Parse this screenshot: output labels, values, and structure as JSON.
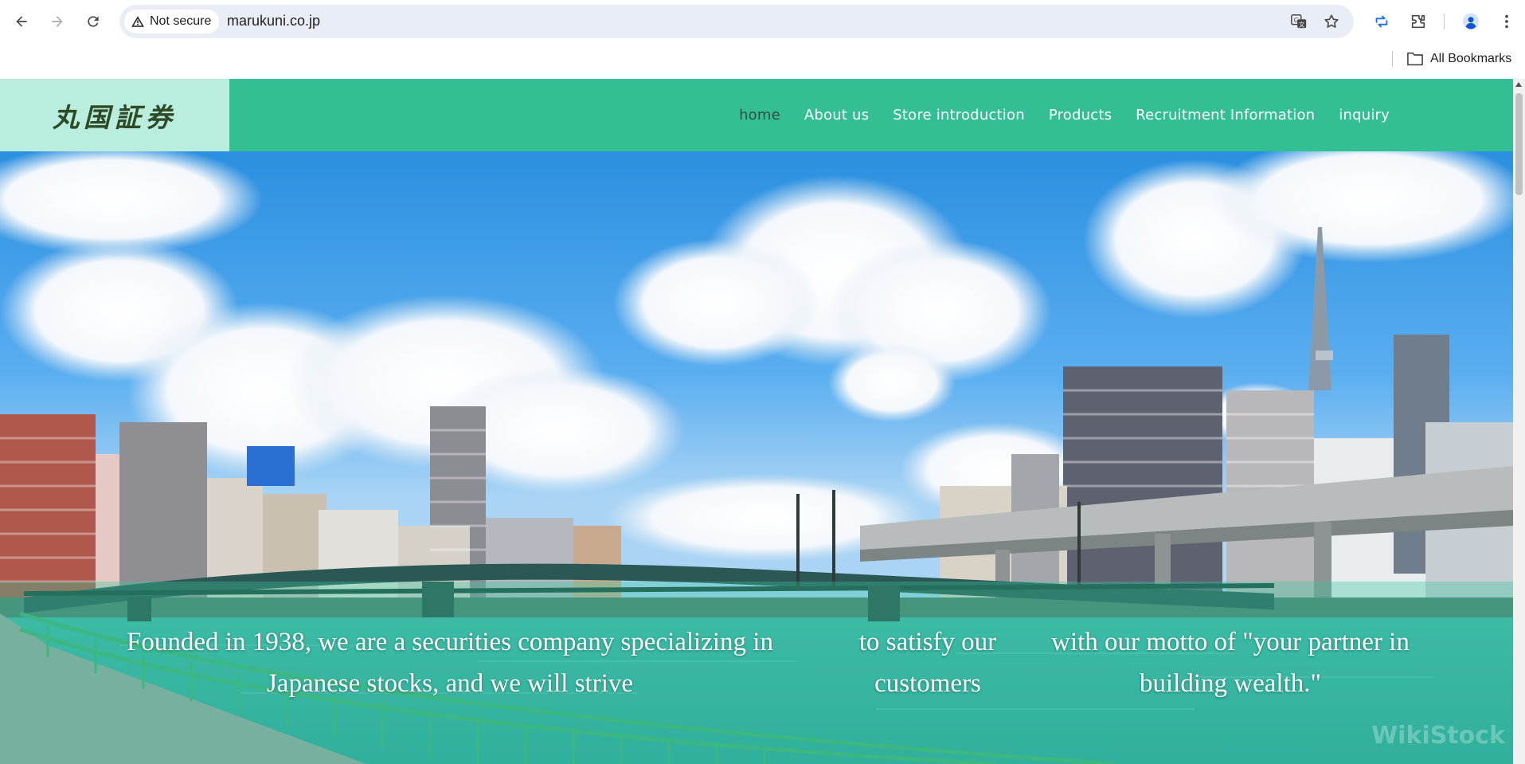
{
  "browser": {
    "security_label": "Not secure",
    "url": "marukuni.co.jp",
    "bookmarks_label": "All Bookmarks"
  },
  "site": {
    "logo_text": "丸国証券",
    "nav": [
      {
        "label": "home",
        "active": true
      },
      {
        "label": "About us"
      },
      {
        "label": "Store introduction"
      },
      {
        "label": "Products"
      },
      {
        "label": "Recruitment Information"
      },
      {
        "label": "inquiry"
      }
    ],
    "hero": {
      "col1_line1": "Founded in 1938, we are a securities company specializing in",
      "col1_line2": "Japanese stocks, and we will strive",
      "col2_line1": "to satisfy our",
      "col2_line2": "customers",
      "col3_line1": "with our motto of \"your partner in",
      "col3_line2": "building wealth.\"",
      "watermark": "WikiStock"
    }
  },
  "colors": {
    "header_green": "#33bf93",
    "logo_bg": "#b9eedf",
    "active_nav": "#2d4f3f"
  }
}
